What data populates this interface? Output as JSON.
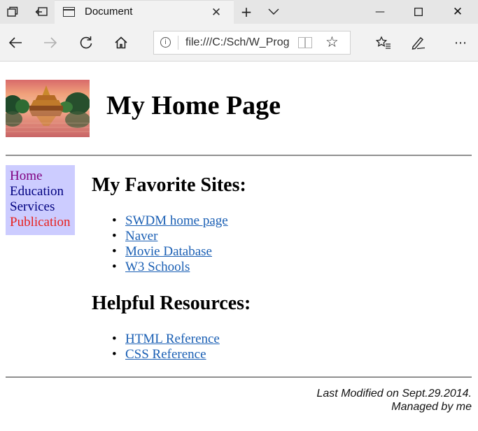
{
  "browser": {
    "tab_title": "Document",
    "address": "file:///C:/Sch/W_Prog",
    "icons": {
      "tab_preview": "tab-preview-icon",
      "set_aside": "set-aside-tabs-icon",
      "close_tab": "close-icon",
      "new_tab": "plus-icon",
      "tab_list": "chevron-down-icon",
      "minimize": "minimize-icon",
      "maximize": "maximize-icon",
      "close_window": "close-icon",
      "back": "back-arrow-icon",
      "forward": "forward-arrow-icon",
      "refresh": "refresh-icon",
      "home": "home-icon",
      "info": "info-icon",
      "reading_view": "reading-view-icon",
      "favorite": "star-icon",
      "favorites_list": "favorites-list-icon",
      "annotate": "pen-icon",
      "more": "more-icon"
    }
  },
  "page": {
    "title": "My Home Page",
    "nav": [
      {
        "label": "Home",
        "color": "#800080"
      },
      {
        "label": "Education",
        "color": "#000080"
      },
      {
        "label": "Services",
        "color": "#000080"
      },
      {
        "label": "Publication",
        "color": "#e8211d"
      }
    ],
    "sections": [
      {
        "heading": "My Favorite Sites:",
        "links": [
          "SWDM home page",
          "Naver",
          "Movie Database",
          "W3 Schools"
        ]
      },
      {
        "heading": "Helpful Resources:",
        "links": [
          "HTML Reference",
          "CSS Reference"
        ]
      }
    ],
    "footer": {
      "modified": "Last Modified on Sept.29.2014.",
      "managed": "Managed by me"
    },
    "colors": {
      "nav_background": "#ccccff",
      "link": "#1a5fb4",
      "rule": "#8f8f8f"
    }
  }
}
